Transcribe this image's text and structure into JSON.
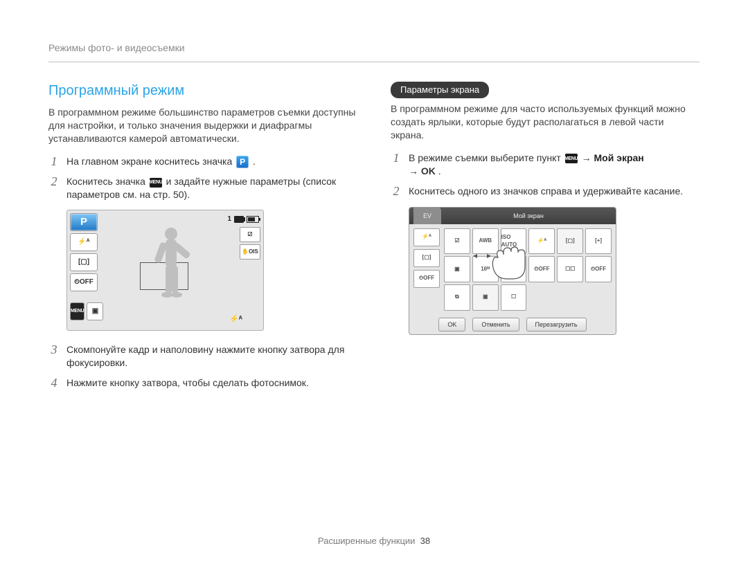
{
  "breadcrumb": "Режимы фото- и видеосъемки",
  "left": {
    "title": "Программный режим",
    "intro": "В программном режиме большинство параметров съемки доступны для настройки, и только значения выдержки и диафрагмы устанавливаются камерой автоматически.",
    "steps": {
      "s1a": "На главном экране коснитесь значка ",
      "s1b": ".",
      "s2a": "Коснитесь значка ",
      "s2b": " и задайте нужные параметры (список параметров см. на стр. 50).",
      "s3": "Скомпонуйте кадр и наполовину нажмите кнопку затвора для фокусировки.",
      "s4": "Нажмите кнопку затвора, чтобы сделать фотоснимок."
    },
    "screen": {
      "counter": "1",
      "p_label": "P",
      "flash_auto": "⚡ᴬ",
      "af_mode": "[▢]",
      "timer_off": "⏲OFF",
      "menu": "MENU",
      "display": "▣",
      "ois": "✋OIS",
      "ev": "☑",
      "bottom_flash": "⚡ᴬ"
    }
  },
  "right": {
    "pill": "Параметры экрана",
    "intro": "В программном режиме для часто используемых функций можно создать ярлыки, которые будут располагаться в левой части экрана.",
    "steps": {
      "s1a": "В режиме съемки выберите пункт ",
      "s1_bold_myscreen": "Мой экран",
      "s1_ok": "OK",
      "s1_arrow": "→",
      "s1_end": ".",
      "s2": "Коснитесь одного из значков справа и удерживайте касание."
    },
    "ui": {
      "tab_ev": "EV",
      "tab_main": "Мой экран",
      "btn_ok": "OK",
      "btn_cancel": "Отменить",
      "btn_reset": "Перезагрузить",
      "left_icons": [
        "⚡ᴬ",
        "[▢]",
        "⏲OFF"
      ],
      "grid": [
        "☑",
        "AWB",
        "ISO\nAUTO",
        "⚡ᴬ",
        "[▢]",
        "[+]",
        "▣",
        "16ᴹ",
        "⧉SF",
        "⏲OFF",
        "☐☐",
        "⏲OFF",
        "⧉",
        "▣",
        "☐"
      ]
    }
  },
  "footer": {
    "label": "Расширенные функции",
    "page": "38"
  },
  "icons": {
    "menu_text": "MENU"
  }
}
